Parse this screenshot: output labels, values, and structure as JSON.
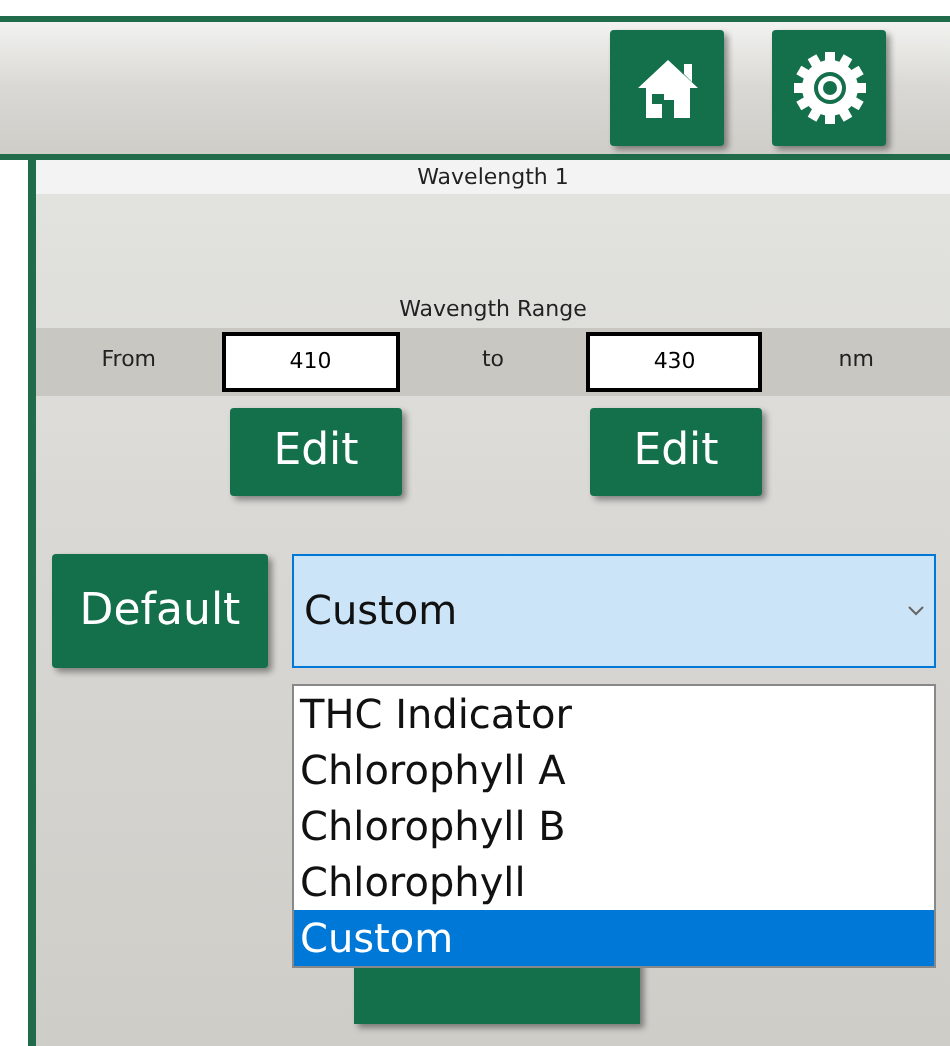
{
  "toolbar": {
    "buttons": [
      {
        "kind": "home"
      },
      {
        "kind": "settings"
      }
    ]
  },
  "panel": {
    "title": "Wavelength 1"
  },
  "range": {
    "label": "Wavength Range",
    "from_label": "From",
    "from_value": "410",
    "to_label": "to",
    "to_value": "430",
    "unit": "nm",
    "edit_buttons": [
      "Edit",
      "Edit"
    ]
  },
  "default_button": "Default",
  "dropdown": {
    "value": "Custom",
    "expanded": true,
    "options": [
      {
        "label": "THC Indicator",
        "selected": false
      },
      {
        "label": "Chlorophyll A",
        "selected": false
      },
      {
        "label": "Chlorophyll B",
        "selected": false
      },
      {
        "label": "Chlorophyll",
        "selected": false
      },
      {
        "label": "Custom",
        "selected": true
      }
    ]
  }
}
